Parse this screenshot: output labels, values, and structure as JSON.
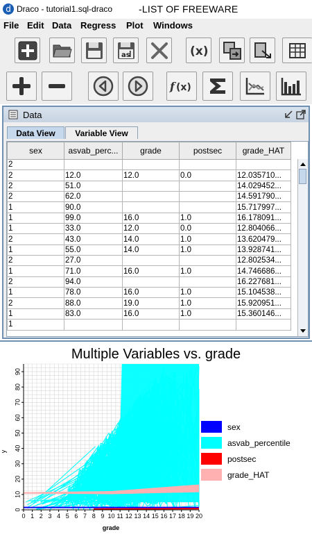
{
  "window": {
    "title": "Draco - tutorial1.sql-draco",
    "note": "-LIST OF FREEWARE",
    "icon": "draco-app-icon"
  },
  "menu": [
    "File",
    "Edit",
    "Data",
    "Regress",
    "Plot",
    "Windows"
  ],
  "toolbar1": [
    {
      "name": "new-icon",
      "glyph": "plus-box"
    },
    {
      "name": "open-folder-icon",
      "glyph": "folder"
    },
    {
      "name": "save-icon",
      "glyph": "floppy"
    },
    {
      "name": "save-as-icon",
      "glyph": "floppy-as",
      "label": "as"
    },
    {
      "name": "close-icon",
      "glyph": "x"
    },
    {
      "name": "variable-x-icon",
      "glyph": "(x)"
    },
    {
      "name": "transform-icon",
      "glyph": "transform"
    },
    {
      "name": "import-icon",
      "glyph": "import"
    },
    {
      "name": "spreadsheet-icon",
      "glyph": "grid"
    }
  ],
  "toolbar2": [
    {
      "name": "add-icon",
      "glyph": "+"
    },
    {
      "name": "remove-icon",
      "glyph": "-"
    },
    {
      "name": "previous-icon",
      "glyph": "left"
    },
    {
      "name": "next-icon",
      "glyph": "right"
    },
    {
      "name": "function-icon",
      "glyph": "f(x)"
    },
    {
      "name": "sum-icon",
      "glyph": "sigma"
    },
    {
      "name": "line-chart-icon",
      "glyph": "line"
    },
    {
      "name": "bar-chart-icon",
      "glyph": "bars"
    }
  ],
  "data_panel": {
    "title": "Data",
    "tabs": [
      "Data View",
      "Variable View"
    ],
    "active_tab": 0,
    "columns": [
      "sex",
      "asvab_perc...",
      "grade",
      "postsec",
      "grade_HAT"
    ],
    "rows": [
      [
        "2",
        "",
        "",
        "",
        ""
      ],
      [
        "2",
        "12.0",
        "12.0",
        "0.0",
        "12.035710..."
      ],
      [
        "2",
        "51.0",
        "",
        "",
        "14.029452..."
      ],
      [
        "2",
        "62.0",
        "",
        "",
        "14.591790..."
      ],
      [
        "1",
        "90.0",
        "",
        "",
        "15.717997..."
      ],
      [
        "1",
        "99.0",
        "16.0",
        "1.0",
        "16.178091..."
      ],
      [
        "1",
        "33.0",
        "12.0",
        "0.0",
        "12.804066..."
      ],
      [
        "2",
        "43.0",
        "14.0",
        "1.0",
        "13.620479..."
      ],
      [
        "1",
        "55.0",
        "14.0",
        "1.0",
        "13.928741..."
      ],
      [
        "2",
        "27.0",
        "",
        "",
        "12.802534..."
      ],
      [
        "1",
        "71.0",
        "16.0",
        "1.0",
        "14.746686..."
      ],
      [
        "2",
        "94.0",
        "",
        "",
        "16.227681..."
      ],
      [
        "1",
        "78.0",
        "16.0",
        "1.0",
        "15.104538..."
      ],
      [
        "2",
        "88.0",
        "19.0",
        "1.0",
        "15.920951..."
      ],
      [
        "1",
        "83.0",
        "16.0",
        "1.0",
        "15.360146..."
      ],
      [
        "1",
        "",
        "",
        "",
        ""
      ]
    ]
  },
  "chart_data": {
    "type": "line",
    "title": "Multiple Variables vs. grade",
    "xlabel": "grade",
    "ylabel": "y",
    "x_ticks": [
      "0",
      "1",
      "2",
      "3",
      "4",
      "5",
      "6",
      "7",
      "8",
      "9",
      "10",
      "11",
      "12",
      "13",
      "14",
      "15",
      "16",
      "17",
      "18",
      "19",
      "20"
    ],
    "y_ticks": [
      "0",
      "10",
      "20",
      "30",
      "40",
      "50",
      "60",
      "70",
      "80",
      "90"
    ],
    "xlim": [
      0,
      20
    ],
    "ylim": [
      0,
      95
    ],
    "grid": true,
    "legend_position": "right",
    "series": [
      {
        "name": "sex",
        "color": "#0000ff",
        "range": [
          1,
          2
        ]
      },
      {
        "name": "asvab_percentile",
        "color": "#00ffff",
        "range": [
          0,
          99
        ]
      },
      {
        "name": "postsec",
        "color": "#ff0000",
        "range": [
          0,
          1
        ]
      },
      {
        "name": "grade_HAT",
        "color": "#ffb0b0",
        "range": [
          11,
          16
        ]
      }
    ]
  }
}
